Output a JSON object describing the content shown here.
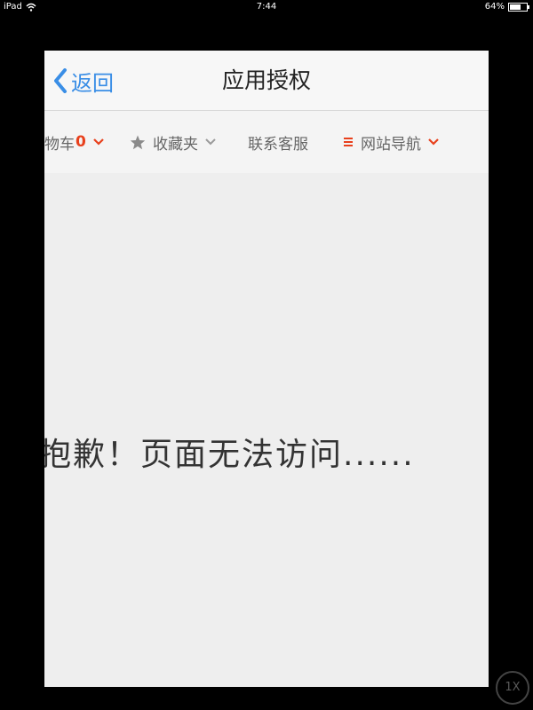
{
  "status_bar": {
    "device": "iPad",
    "time": "7:44",
    "battery": "64%"
  },
  "nav": {
    "back_label": "返回",
    "title": "应用授权"
  },
  "toolbar": {
    "cart_label": "物车",
    "cart_count": "0",
    "favorites_label": "收藏夹",
    "contact_label": "联系客服",
    "site_nav_label": "网站导航"
  },
  "main": {
    "error_message": "抱歉！页面无法访问......"
  },
  "zoom": {
    "label": "1X"
  },
  "colors": {
    "accent_blue": "#3a8ee6",
    "accent_orange": "#e8401c"
  },
  "icons": [
    "wifi-icon",
    "battery-icon",
    "chevron-left-icon",
    "chevron-down-icon",
    "star-icon",
    "menu-icon"
  ]
}
